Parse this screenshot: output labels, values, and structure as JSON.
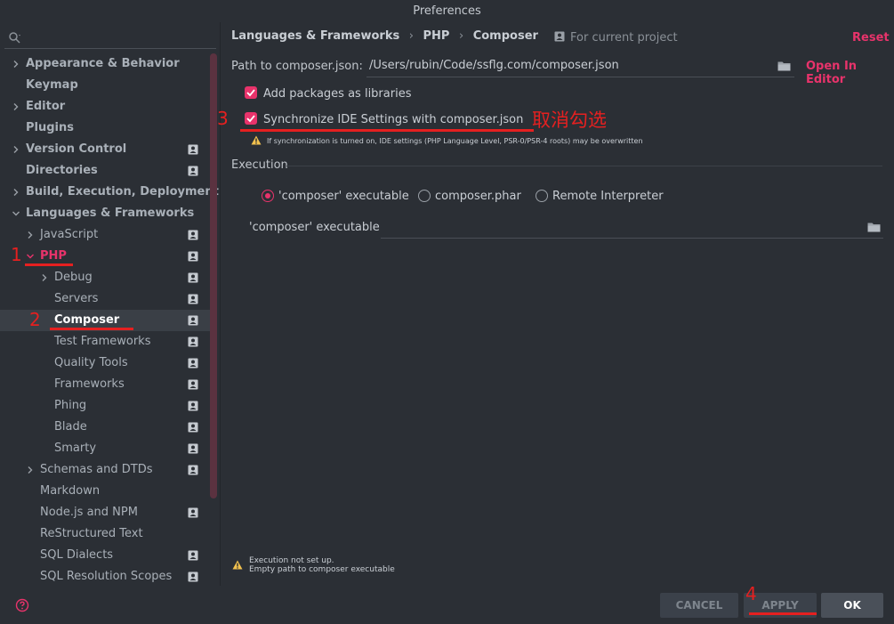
{
  "window": {
    "title": "Preferences"
  },
  "sidebar": {
    "search_placeholder": "",
    "items": [
      {
        "label": "Appearance & Behavior",
        "chevron": "right",
        "bold": true,
        "project": false
      },
      {
        "label": "Keymap",
        "chevron": "",
        "bold": true,
        "project": false
      },
      {
        "label": "Editor",
        "chevron": "right",
        "bold": true,
        "project": false
      },
      {
        "label": "Plugins",
        "chevron": "",
        "bold": true,
        "project": false
      },
      {
        "label": "Version Control",
        "chevron": "right",
        "bold": true,
        "project": true
      },
      {
        "label": "Directories",
        "chevron": "",
        "bold": true,
        "project": true
      },
      {
        "label": "Build, Execution, Deployment",
        "chevron": "right",
        "bold": true,
        "project": false
      },
      {
        "label": "Languages & Frameworks",
        "chevron": "down",
        "bold": true,
        "project": false
      },
      {
        "label": "JavaScript",
        "chevron": "right",
        "bold": false,
        "project": true
      },
      {
        "label": "PHP",
        "chevron": "down",
        "bold": false,
        "project": true
      },
      {
        "label": "Debug",
        "chevron": "right",
        "bold": false,
        "project": true
      },
      {
        "label": "Servers",
        "chevron": "",
        "bold": false,
        "project": true
      },
      {
        "label": "Composer",
        "chevron": "",
        "bold": false,
        "project": true
      },
      {
        "label": "Test Frameworks",
        "chevron": "",
        "bold": false,
        "project": true
      },
      {
        "label": "Quality Tools",
        "chevron": "",
        "bold": false,
        "project": true
      },
      {
        "label": "Frameworks",
        "chevron": "",
        "bold": false,
        "project": true
      },
      {
        "label": "Phing",
        "chevron": "",
        "bold": false,
        "project": true
      },
      {
        "label": "Blade",
        "chevron": "",
        "bold": false,
        "project": true
      },
      {
        "label": "Smarty",
        "chevron": "",
        "bold": false,
        "project": true
      },
      {
        "label": "Schemas and DTDs",
        "chevron": "right",
        "bold": false,
        "project": true
      },
      {
        "label": "Markdown",
        "chevron": "",
        "bold": false,
        "project": false
      },
      {
        "label": "Node.js and NPM",
        "chevron": "",
        "bold": false,
        "project": true
      },
      {
        "label": "ReStructured Text",
        "chevron": "",
        "bold": false,
        "project": false
      },
      {
        "label": "SQL Dialects",
        "chevron": "",
        "bold": false,
        "project": true
      },
      {
        "label": "SQL Resolution Scopes",
        "chevron": "",
        "bold": false,
        "project": true
      }
    ]
  },
  "breadcrumb": {
    "items": [
      "Languages & Frameworks",
      "PHP",
      "Composer"
    ],
    "separator": "›"
  },
  "header": {
    "for_project": "For current project",
    "reset": "Reset"
  },
  "main": {
    "path_label": "Path to composer.json:",
    "path_value": "/Users/rubin/Code/ssflg.com/composer.json",
    "open_in_editor": "Open In Editor",
    "add_packages_label": "Add packages as libraries",
    "add_packages_checked": true,
    "sync_label": "Synchronize IDE Settings with composer.json",
    "sync_checked": true,
    "sync_warning": "If synchronization is turned on, IDE settings (PHP Language Level, PSR-0/PSR-4 roots) may be overwritten",
    "execution_label": "Execution",
    "radio_composer_exe": "'composer' executable",
    "radio_composer_phar": "composer.phar",
    "radio_remote": "Remote Interpreter",
    "selected_radio": "composer-executable",
    "exec_field_label": "'composer' executable",
    "exec_field_value": "",
    "bottom_warning_line1": "Execution not set up.",
    "bottom_warning_line2": "Empty path to composer executable"
  },
  "footer": {
    "cancel": "CANCEL",
    "apply": "APPLY",
    "ok": "OK"
  },
  "annotations": {
    "n1": "1",
    "n2": "2",
    "n3": "3",
    "n4": "4",
    "note": "取消勾选"
  },
  "colors": {
    "accent": "#e8336b",
    "annotation": "#e52020",
    "background": "#2b2f35"
  }
}
